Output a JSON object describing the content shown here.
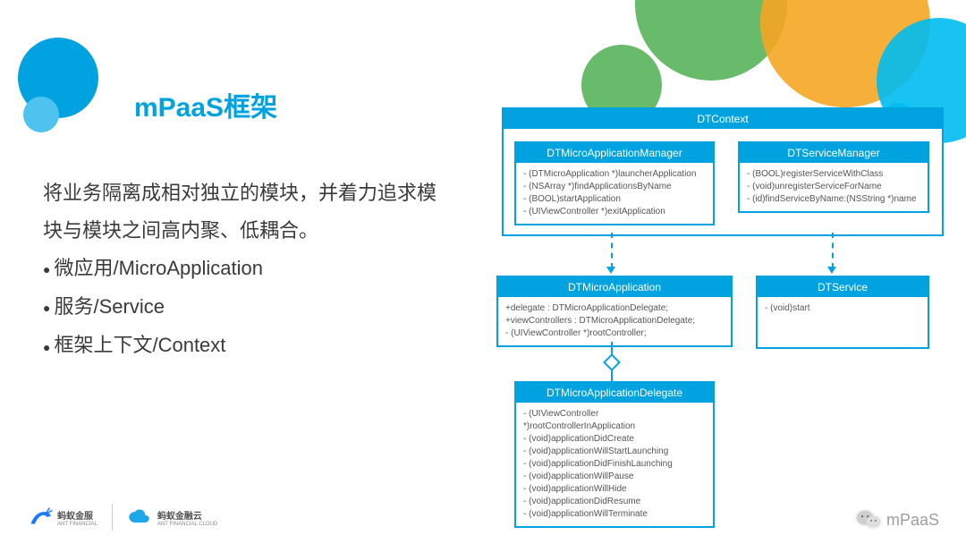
{
  "title": "mPaaS框架",
  "description": "将业务隔离成相对独立的模块，并着力追求模块与模块之间高内聚、低耦合。",
  "bullets": [
    "微应用/MicroApplication",
    "服务/Service",
    "框架上下文/Context"
  ],
  "diagram": {
    "context": {
      "title": "DTContext"
    },
    "appManager": {
      "title": "DTMicroApplicationManager",
      "lines": [
        "- (DTMicroApplication *)launcherApplication",
        "- (NSArray *)findApplicationsByName",
        "- (BOOL)startApplication",
        "- (UIViewController *)exitApplication"
      ]
    },
    "serviceManager": {
      "title": "DTServiceManager",
      "lines": [
        "- (BOOL)registerServiceWithClass",
        "- (void)unregisterServiceForName",
        "- (id)findServiceByName:(NSString *)name"
      ]
    },
    "microApp": {
      "title": "DTMicroApplication",
      "lines": [
        "+delegate : DTMicroApplicationDelegate;",
        "+viewControllers : DTMicroApplicationDelegate;",
        "- (UIViewController *)rootController;"
      ]
    },
    "service": {
      "title": "DTService",
      "lines": [
        "- (void)start"
      ]
    },
    "delegate": {
      "title": "DTMicroApplicationDelegate",
      "lines": [
        "- (UIViewController",
        "*)rootControllerInApplication",
        "- (void)applicationDidCreate",
        "- (void)applicationWillStartLaunching",
        "- (void)applicationDidFinishLaunching",
        "- (void)applicationWillPause",
        "- (void)applicationWillHide",
        "- (void)applicationDidResume",
        "- (void)applicationWillTerminate"
      ]
    }
  },
  "footer": {
    "ant_financial_cn": "蚂蚁金服",
    "ant_financial_en": "ANT FINANCIAL",
    "ant_cloud_cn": "蚂蚁金融云",
    "ant_cloud_en": "ANT FINANCIAL CLOUD"
  },
  "wechat_label": "mPaaS"
}
